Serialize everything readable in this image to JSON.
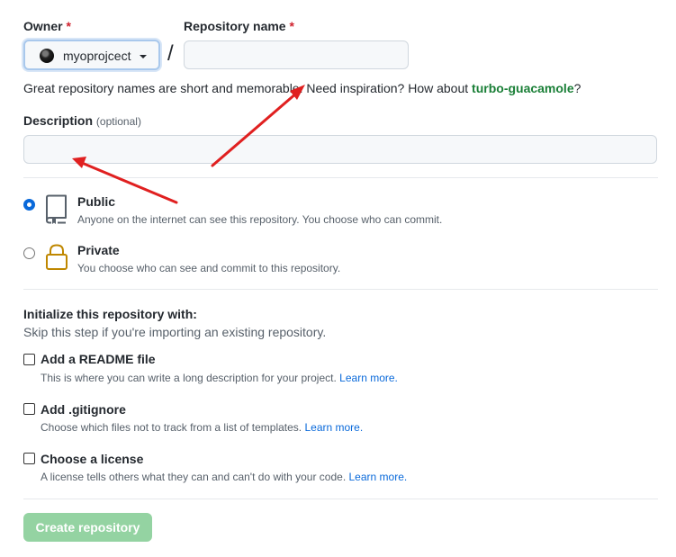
{
  "owner": {
    "label": "Owner",
    "required_mark": "*",
    "value": "myoprojcect"
  },
  "repo_name": {
    "label": "Repository name",
    "required_mark": "*",
    "value": "",
    "placeholder": ""
  },
  "separator": "/",
  "name_hint": {
    "text": "Great repository names are short and memorable. Need inspiration? How about ",
    "suggestion": "turbo-guacamole",
    "end": "?"
  },
  "description": {
    "label": "Description",
    "optional": "(optional)",
    "value": ""
  },
  "visibility": {
    "options": [
      {
        "title": "Public",
        "desc": "Anyone on the internet can see this repository. You choose who can commit.",
        "checked": true
      },
      {
        "title": "Private",
        "desc": "You choose who can see and commit to this repository.",
        "checked": false
      }
    ]
  },
  "initialize": {
    "title": "Initialize this repository with:",
    "subtitle": "Skip this step if you're importing an existing repository.",
    "options": [
      {
        "title": "Add a README file",
        "desc": "This is where you can write a long description for your project.",
        "link": "Learn more."
      },
      {
        "title": "Add .gitignore",
        "desc": "Choose which files not to track from a list of templates.",
        "link": "Learn more."
      },
      {
        "title": "Choose a license",
        "desc": "A license tells others what they can and can't do with your code.",
        "link": "Learn more."
      }
    ]
  },
  "submit": {
    "label": "Create repository",
    "disabled": true
  },
  "colors": {
    "accent": "#0969da",
    "suggestion": "#1a7f37",
    "required": "#cf222e",
    "submit_disabled": "#94d3a2",
    "annotation_arrow": "#e02020"
  },
  "icons": {
    "public": "repo-book-icon",
    "private": "padlock-icon",
    "caret": "caret-down-icon"
  }
}
